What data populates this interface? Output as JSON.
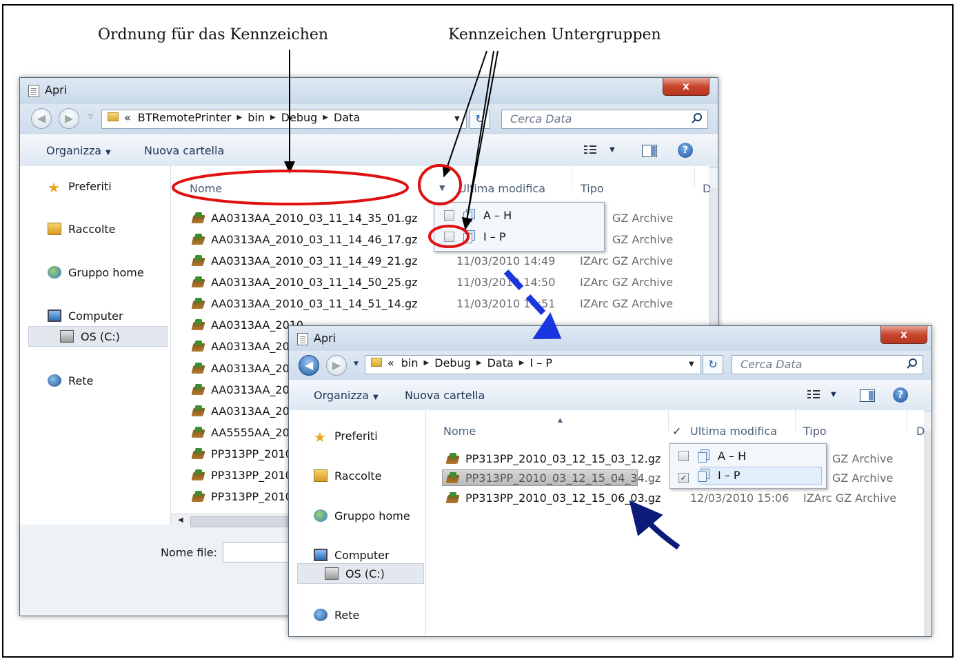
{
  "captions": {
    "left": "Ordnung für das Kennzeichen",
    "right": "Kennzeichen Untergruppen"
  },
  "colors": {
    "highlight_red": "#e01010",
    "arrow_blue": "#1a36e0",
    "arrow_navy": "#0c1a7a"
  },
  "win1": {
    "title": "Apri",
    "close_label": "x",
    "breadcrumb": [
      "«",
      "BTRemotePrinter",
      "bin",
      "Debug",
      "Data"
    ],
    "search_placeholder": "Cerca Data",
    "toolbar": {
      "organize": "Organizza",
      "new_folder": "Nuova cartella"
    },
    "nav": [
      "Preferiti",
      "Raccolte",
      "Gruppo home",
      "Computer",
      "OS (C:)",
      "Rete"
    ],
    "columns": {
      "name": "Nome",
      "modified": "Ultima modifica",
      "type": "Tipo",
      "more": "D"
    },
    "files": [
      {
        "name": "AA0313AA_2010_03_11_14_35_01.gz",
        "date": "",
        "type": "GZ Archive"
      },
      {
        "name": "AA0313AA_2010_03_11_14_46_17.gz",
        "date": "",
        "type": "GZ Archive"
      },
      {
        "name": "AA0313AA_2010_03_11_14_49_21.gz",
        "date": "11/03/2010 14:49",
        "type": "IZArc GZ Archive"
      },
      {
        "name": "AA0313AA_2010_03_11_14_50_25.gz",
        "date": "11/03/2010 14:50",
        "type": "IZArc GZ Archive"
      },
      {
        "name": "AA0313AA_2010_03_11_14_51_14.gz",
        "date": "11/03/2010 14:51",
        "type": "IZArc GZ Archive"
      },
      {
        "name": "AA0313AA_2010",
        "date": "",
        "type": ""
      },
      {
        "name": "AA0313AA_201",
        "date": "",
        "type": ""
      },
      {
        "name": "AA0313AA_201",
        "date": "",
        "type": ""
      },
      {
        "name": "AA0313AA_201",
        "date": "",
        "type": ""
      },
      {
        "name": "AA0313AA_201",
        "date": "",
        "type": ""
      },
      {
        "name": "AA5555AA_201",
        "date": "",
        "type": ""
      },
      {
        "name": "PP313PP_2010",
        "date": "",
        "type": ""
      },
      {
        "name": "PP313PP_2010",
        "date": "",
        "type": ""
      },
      {
        "name": "PP313PP_2010",
        "date": "",
        "type": ""
      }
    ],
    "filter": [
      {
        "label": "A – H",
        "checked": false
      },
      {
        "label": "I – P",
        "checked": false
      }
    ],
    "filename_label": "Nome file:",
    "filename_value": ""
  },
  "win2": {
    "title": "Apri",
    "close_label": "x",
    "breadcrumb": [
      "«",
      "bin",
      "Debug",
      "Data",
      "I – P"
    ],
    "search_placeholder": "Cerca Data",
    "toolbar": {
      "organize": "Organizza",
      "new_folder": "Nuova cartella"
    },
    "nav": [
      "Preferiti",
      "Raccolte",
      "Gruppo home",
      "Computer",
      "OS (C:)",
      "Rete"
    ],
    "columns": {
      "name": "Nome",
      "modified": "Ultima modifica",
      "type": "Tipo",
      "more": "D",
      "check": "✓"
    },
    "files": [
      {
        "name": "PP313PP_2010_03_12_15_03_12.gz",
        "date": "",
        "type": "GZ Archive",
        "selected": false
      },
      {
        "name": "PP313PP_2010_03_12_15_04_34.gz",
        "date": "",
        "type": "GZ Archive",
        "selected": true
      },
      {
        "name": "PP313PP_2010_03_12_15_06_03.gz",
        "date": "12/03/2010 15:06",
        "type": "IZArc GZ Archive",
        "selected": false
      }
    ],
    "filter": [
      {
        "label": "A – H",
        "checked": false
      },
      {
        "label": "I – P",
        "checked": true
      }
    ]
  }
}
